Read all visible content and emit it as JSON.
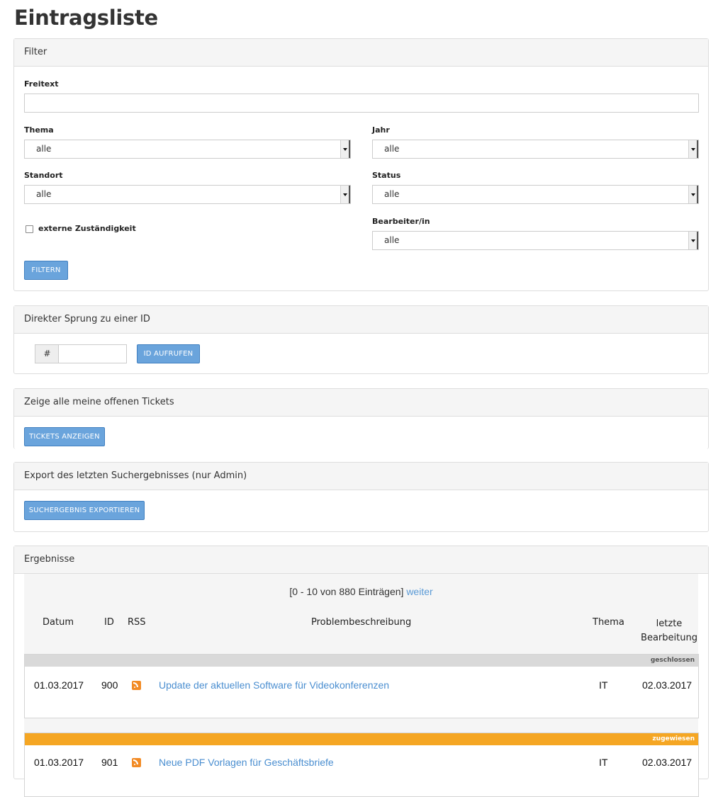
{
  "page": {
    "title": "Eintragsliste"
  },
  "filter": {
    "heading": "Filter",
    "freitext_label": "Freitext",
    "freitext_value": "",
    "thema_label": "Thema",
    "thema_value": "alle",
    "jahr_label": "Jahr",
    "jahr_value": "alle",
    "standort_label": "Standort",
    "standort_value": "alle",
    "status_label": "Status",
    "status_value": "alle",
    "extern_label": "externe Zuständigkeit",
    "extern_checked": false,
    "bearbeiter_label": "Bearbeiter/in",
    "bearbeiter_value": "alle",
    "submit_label": "FILTERN"
  },
  "jump": {
    "heading": "Direkter Sprung zu einer ID",
    "prefix": "#",
    "id_value": "",
    "button_label": "ID AUFRUFEN"
  },
  "tickets": {
    "heading": "Zeige alle meine offenen Tickets",
    "button_label": "TICKETS ANZEIGEN"
  },
  "export": {
    "heading": "Export des letzten Suchergebnisses (nur Admin)",
    "button_label": "SUCHERGEBNIS EXPORTIEREN"
  },
  "results": {
    "heading": "Ergebnisse",
    "pager_text": "[0 - 10 von 880 Einträgen]",
    "pager_next": "weiter",
    "columns": {
      "datum": "Datum",
      "id": "ID",
      "rss": "RSS",
      "beschreibung": "Problembeschreibung",
      "thema": "Thema",
      "bearbeitung_line1": "letzte",
      "bearbeitung_line2": "Bearbeitung"
    },
    "rows": [
      {
        "status": "geschlossen",
        "status_color": "#d9d9d9",
        "status_text_color": "#555555",
        "datum": "01.03.2017",
        "id": "900",
        "beschreibung": "Update der aktuellen Software für Videokonferenzen",
        "thema": "IT",
        "letzte_bearbeitung": "02.03.2017"
      },
      {
        "status": "zugewiesen",
        "status_color": "#f5a623",
        "status_text_color": "#ffffff",
        "datum": "01.03.2017",
        "id": "901",
        "beschreibung": "Neue PDF Vorlagen für Geschäftsbriefe",
        "thema": "IT",
        "letzte_bearbeitung": "02.03.2017"
      }
    ]
  },
  "colors": {
    "accent_button": "#6aa4dc",
    "link": "#4a8ed0",
    "rss": "#f28b25"
  }
}
